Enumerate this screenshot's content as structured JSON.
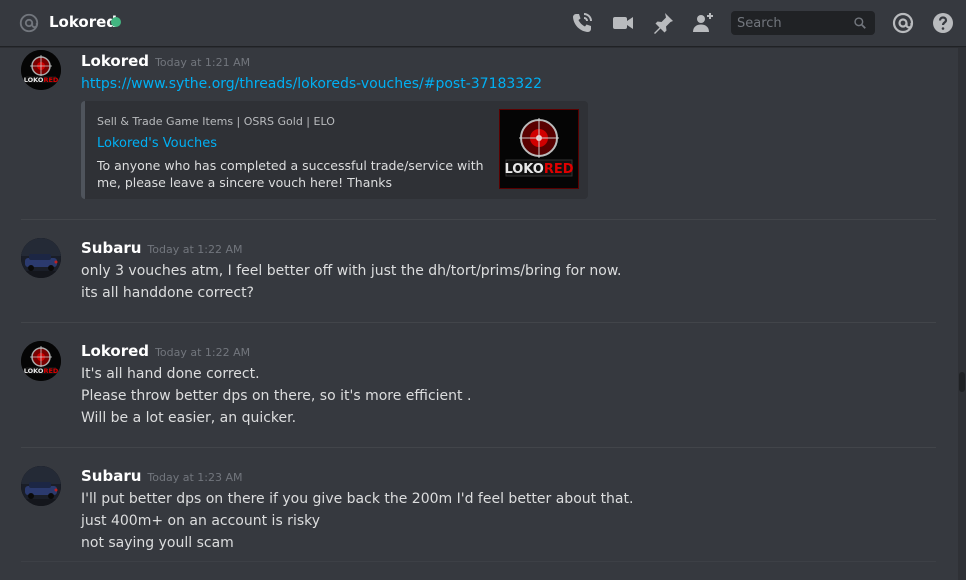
{
  "header": {
    "channel_name": "Lokored",
    "status_color": "#43b581",
    "icons": [
      "at-icon",
      "call-icon",
      "video-icon",
      "pin-icon",
      "add-friend-icon",
      "mention-icon",
      "help-icon"
    ],
    "search_placeholder": "Search"
  },
  "messages": [
    {
      "author": "Lokored",
      "timestamp": "Today at 1:21 AM",
      "lines": [
        "https://www.sythe.org/threads/lokoreds-vouches/#post-37183322"
      ],
      "embed": {
        "provider": "Sell & Trade Game Items | OSRS Gold | ELO",
        "title": "Lokored's Vouches",
        "description": "To anyone who has completed a successful trade/service with me, please leave a sincere vouch here! Thanks"
      }
    },
    {
      "author": "Subaru",
      "timestamp": "Today at 1:22 AM",
      "lines": [
        "only 3 vouches atm, I feel better off with just the dh/tort/prims/bring for now.",
        "its all handdone correct?"
      ]
    },
    {
      "author": "Lokored",
      "timestamp": "Today at 1:22 AM",
      "lines": [
        "It's all hand done correct.",
        "Please throw better dps on there, so it's more efficient .",
        "Will be a lot easier, an quicker."
      ]
    },
    {
      "author": "Subaru",
      "timestamp": "Today at 1:23 AM",
      "lines": [
        "I'll put better dps on there if you give back the 200m I'd feel better about that.",
        "just 400m+ on an account is risky",
        "not saying youll scam"
      ]
    }
  ],
  "avatars": {
    "lokored_logo_text": "LOKORED"
  }
}
